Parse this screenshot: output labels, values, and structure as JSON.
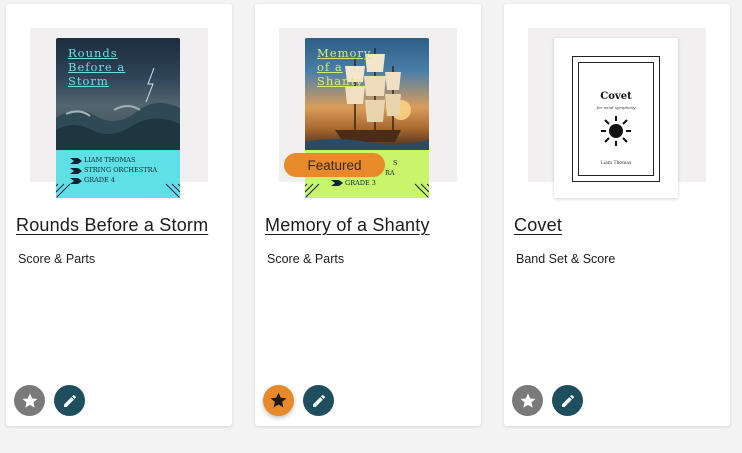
{
  "cards": [
    {
      "title": "Rounds Before a Storm",
      "subtitle": "Score & Parts",
      "cover": {
        "title_lines": [
          "Rounds",
          "Before a",
          "Storm"
        ],
        "composer": "LIAM THOMAS",
        "ensemble": "STRING ORCHESTRA",
        "grade": "GRADE 4"
      }
    },
    {
      "title": "Memory of a Shanty",
      "subtitle": "Score & Parts",
      "badge": "Featured",
      "cover": {
        "title_lines": [
          "Memory",
          "of a",
          "Shanty"
        ],
        "composer_partial": "S",
        "ensemble_partial": "RA",
        "grade": "GRADE 3"
      }
    },
    {
      "title": "Covet",
      "subtitle": "Band Set & Score",
      "cover": {
        "title": "Covet",
        "subtitle": "for wind symphony",
        "author": "Liam Thomas"
      }
    }
  ],
  "colors": {
    "accent_orange": "#e8892a",
    "edit_teal": "#1f4e5f",
    "star_inactive": "#7a7a7a"
  },
  "icons": {
    "favorite": "star-icon",
    "edit": "pencil-icon"
  }
}
